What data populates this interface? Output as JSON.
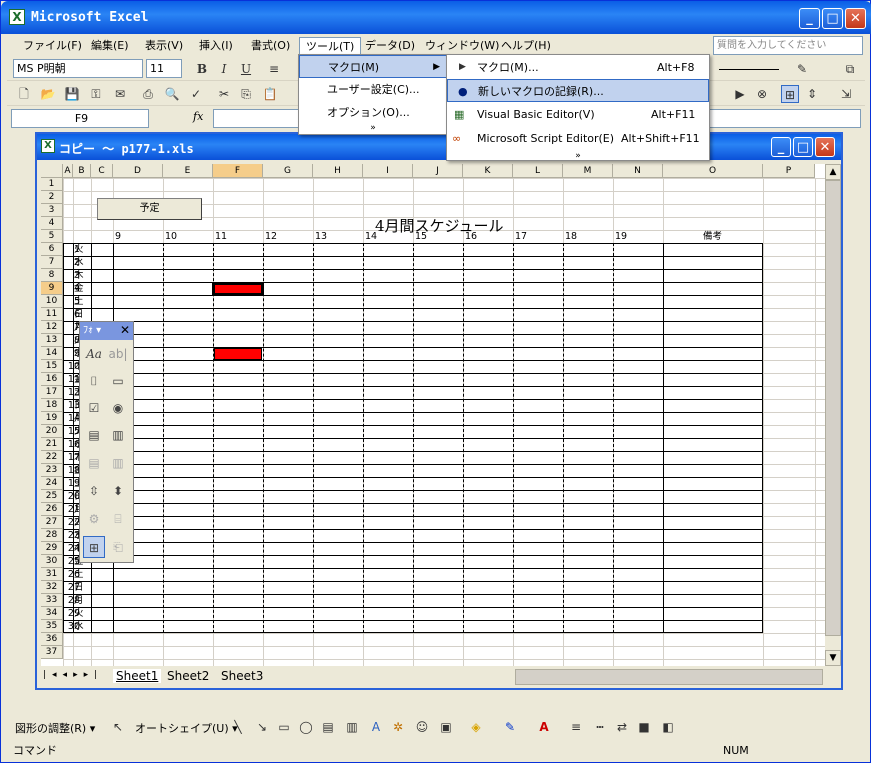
{
  "app": {
    "title": "Microsoft Excel"
  },
  "menubar": {
    "items": [
      "ファイル(F)",
      "編集(E)",
      "表示(V)",
      "挿入(I)",
      "書式(O)",
      "ツール(T)",
      "データ(D)",
      "ウィンドウ(W)",
      "ヘルプ(H)"
    ],
    "help_placeholder": "質問を入力してください"
  },
  "format_toolbar": {
    "font_name": "MS P明朝",
    "font_size": "11"
  },
  "formula_bar": {
    "name_box": "F9",
    "fx": "fx"
  },
  "workbook": {
    "title": "コピー ～ p177-1.xls"
  },
  "columns": [
    "A",
    "B",
    "C",
    "D",
    "E",
    "F",
    "G",
    "H",
    "I",
    "J",
    "K",
    "L",
    "M",
    "N",
    "O",
    "P"
  ],
  "rows": [
    "1",
    "2",
    "3",
    "4",
    "5",
    "6",
    "7",
    "8",
    "9",
    "10",
    "11",
    "12",
    "13",
    "14",
    "15",
    "16",
    "17",
    "18",
    "19",
    "20",
    "21",
    "22",
    "23",
    "24",
    "25",
    "26",
    "27",
    "28",
    "29",
    "30",
    "31",
    "32",
    "33",
    "34",
    "35",
    "36",
    "37"
  ],
  "sheet": {
    "button_label": "予定",
    "schedule_title": "4月間スケジュール",
    "hours": [
      "9",
      "10",
      "11",
      "12",
      "13",
      "14",
      "15",
      "16",
      "17",
      "18",
      "19"
    ],
    "remarks_header": "備考",
    "days": [
      [
        "1",
        "火"
      ],
      [
        "2",
        "水"
      ],
      [
        "3",
        "木"
      ],
      [
        "4",
        "金"
      ],
      [
        "5",
        "土"
      ],
      [
        "6",
        "日"
      ],
      [
        "7",
        "月"
      ],
      [
        "8",
        "火"
      ],
      [
        "9",
        "水"
      ],
      [
        "10",
        "木"
      ],
      [
        "11",
        "金"
      ],
      [
        "12",
        "土"
      ],
      [
        "13",
        "日"
      ],
      [
        "14",
        "月"
      ],
      [
        "15",
        "火"
      ],
      [
        "16",
        "水"
      ],
      [
        "17",
        "木"
      ],
      [
        "18",
        "金"
      ],
      [
        "19",
        "土"
      ],
      [
        "20",
        "日"
      ],
      [
        "21",
        "月"
      ],
      [
        "22",
        "火"
      ],
      [
        "23",
        "水"
      ],
      [
        "24",
        "木"
      ],
      [
        "25",
        "金"
      ],
      [
        "26",
        "土"
      ],
      [
        "27",
        "日"
      ],
      [
        "28",
        "月"
      ],
      [
        "29",
        "火"
      ],
      [
        "30",
        "水"
      ]
    ]
  },
  "tools_menu": {
    "items": [
      "マクロ(M)",
      "ユーザー設定(C)...",
      "オプション(O)..."
    ],
    "more": "»"
  },
  "macro_submenu": {
    "items": [
      {
        "label": "マクロ(M)...",
        "shortcut": "Alt+F8"
      },
      {
        "label": "新しいマクロの記録(R)...",
        "shortcut": ""
      },
      {
        "label": "Visual Basic Editor(V)",
        "shortcut": "Alt+F11"
      },
      {
        "label": "Microsoft Script Editor(E)",
        "shortcut": "Alt+Shift+F11"
      }
    ],
    "more": "»"
  },
  "forms_toolbar": {
    "title": "ﾌｫ"
  },
  "sheet_tabs": [
    "Sheet1",
    "Sheet2",
    "Sheet3"
  ],
  "drawing_toolbar": {
    "adjust": "図形の調整(R) ▾",
    "autoshape": "オートシェイプ(U) ▾"
  },
  "status": {
    "left": "コマンド",
    "num": "NUM"
  },
  "colors": {
    "title_blue": "#0a5ee6",
    "highlight": "#c1d2ee",
    "red_bar": "#ff0000",
    "selected_header": "#f5cd8a"
  }
}
